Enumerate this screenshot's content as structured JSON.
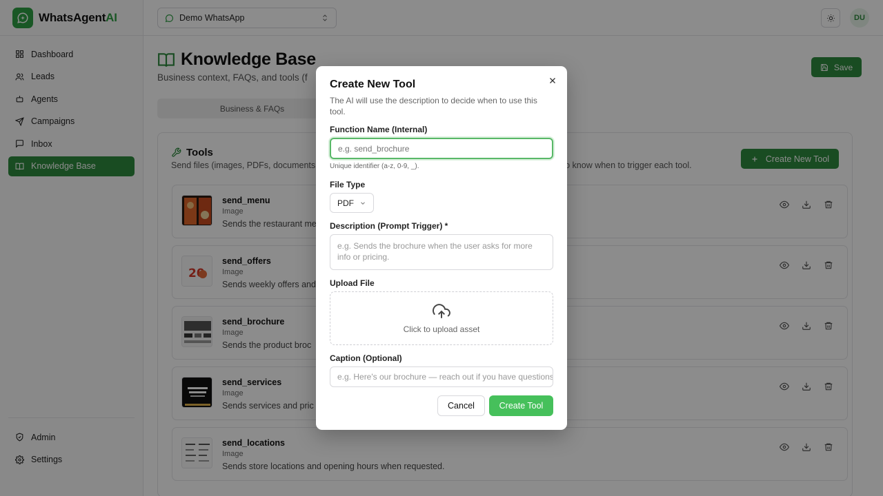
{
  "brand": {
    "name_main": "WhatsAgent",
    "name_accent": "AI"
  },
  "nav": {
    "items": [
      {
        "label": "Dashboard",
        "icon": "grid-icon"
      },
      {
        "label": "Leads",
        "icon": "users-icon"
      },
      {
        "label": "Agents",
        "icon": "bot-icon"
      },
      {
        "label": "Campaigns",
        "icon": "send-icon"
      },
      {
        "label": "Inbox",
        "icon": "message-icon"
      },
      {
        "label": "Knowledge Base",
        "icon": "book-icon",
        "active": true
      }
    ],
    "bottom": [
      {
        "label": "Admin",
        "icon": "shield-icon"
      },
      {
        "label": "Settings",
        "icon": "gear-icon"
      }
    ]
  },
  "topbar": {
    "workspace": "Demo WhatsApp",
    "avatar_initials": "DU"
  },
  "page": {
    "title": "Knowledge Base",
    "subtitle": "Business context, FAQs, and tools (f",
    "save_label": "Save",
    "tabs": [
      "Business & FAQs",
      ""
    ]
  },
  "tools_card": {
    "title": "Tools",
    "subtitle_left": "Send files (images, PDFs, documents",
    "subtitle_right": "o know when to trigger each tool.",
    "create_label": "Create New Tool",
    "rows": [
      {
        "name": "send_menu",
        "type": "Image",
        "desc": "Sends the restaurant me"
      },
      {
        "name": "send_offers",
        "type": "Image",
        "desc": "Sends weekly offers and"
      },
      {
        "name": "send_brochure",
        "type": "Image",
        "desc": "Sends the product broc"
      },
      {
        "name": "send_services",
        "type": "Image",
        "desc": "Sends services and pric"
      },
      {
        "name": "send_locations",
        "type": "Image",
        "desc": "Sends store locations and opening hours when requested."
      }
    ]
  },
  "modal": {
    "title": "Create New Tool",
    "description": "The AI will use the description to decide when to use this tool.",
    "function_name_label": "Function Name (Internal)",
    "function_name_placeholder": "e.g. send_brochure",
    "function_name_hint": "Unique identifier (a-z, 0-9, _).",
    "file_type_label": "File Type",
    "file_type_value": "PDF",
    "description_label": "Description (Prompt Trigger) *",
    "description_placeholder": "e.g. Sends the brochure when the user asks for more info or pricing.",
    "upload_label": "Upload File",
    "upload_text": "Click to upload asset",
    "caption_label": "Caption (Optional)",
    "caption_placeholder": "e.g. Here's our brochure — reach out if you have questions",
    "cancel_label": "Cancel",
    "create_label": "Create Tool"
  },
  "colors": {
    "accent": "#2f8a3f",
    "accent_light": "#46c05b"
  }
}
